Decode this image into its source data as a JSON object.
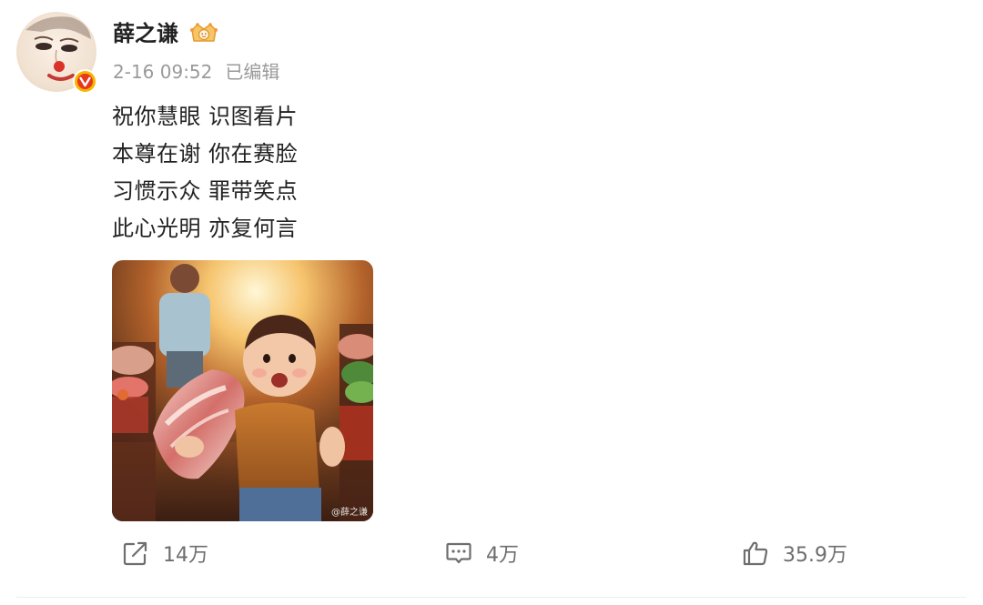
{
  "author": {
    "name": "薛之谦",
    "avatar_icon": "avatar-portrait",
    "verify_icon": "verified-v-icon",
    "badge_icon": "crown-medal-icon"
  },
  "meta": {
    "time": "2-16 09:52",
    "edited": "已编辑"
  },
  "content": {
    "lines": [
      "祝你慧眼 识图看片",
      "本尊在谢 你在赛脸",
      "习惯示众 罪带笑点",
      "此心光明 亦复何言"
    ]
  },
  "image": {
    "watermark": "薛之谦"
  },
  "actions": {
    "repost": {
      "icon": "share-icon",
      "count": "14万"
    },
    "comment": {
      "icon": "comment-icon",
      "count": "4万"
    },
    "like": {
      "icon": "thumbs-up-icon",
      "count": "35.9万"
    }
  },
  "colors": {
    "verify_outer": "#f7b500",
    "verify_inner": "#e8371d",
    "meta_text": "#9a9a9a",
    "action_text": "#6e6e6e"
  }
}
